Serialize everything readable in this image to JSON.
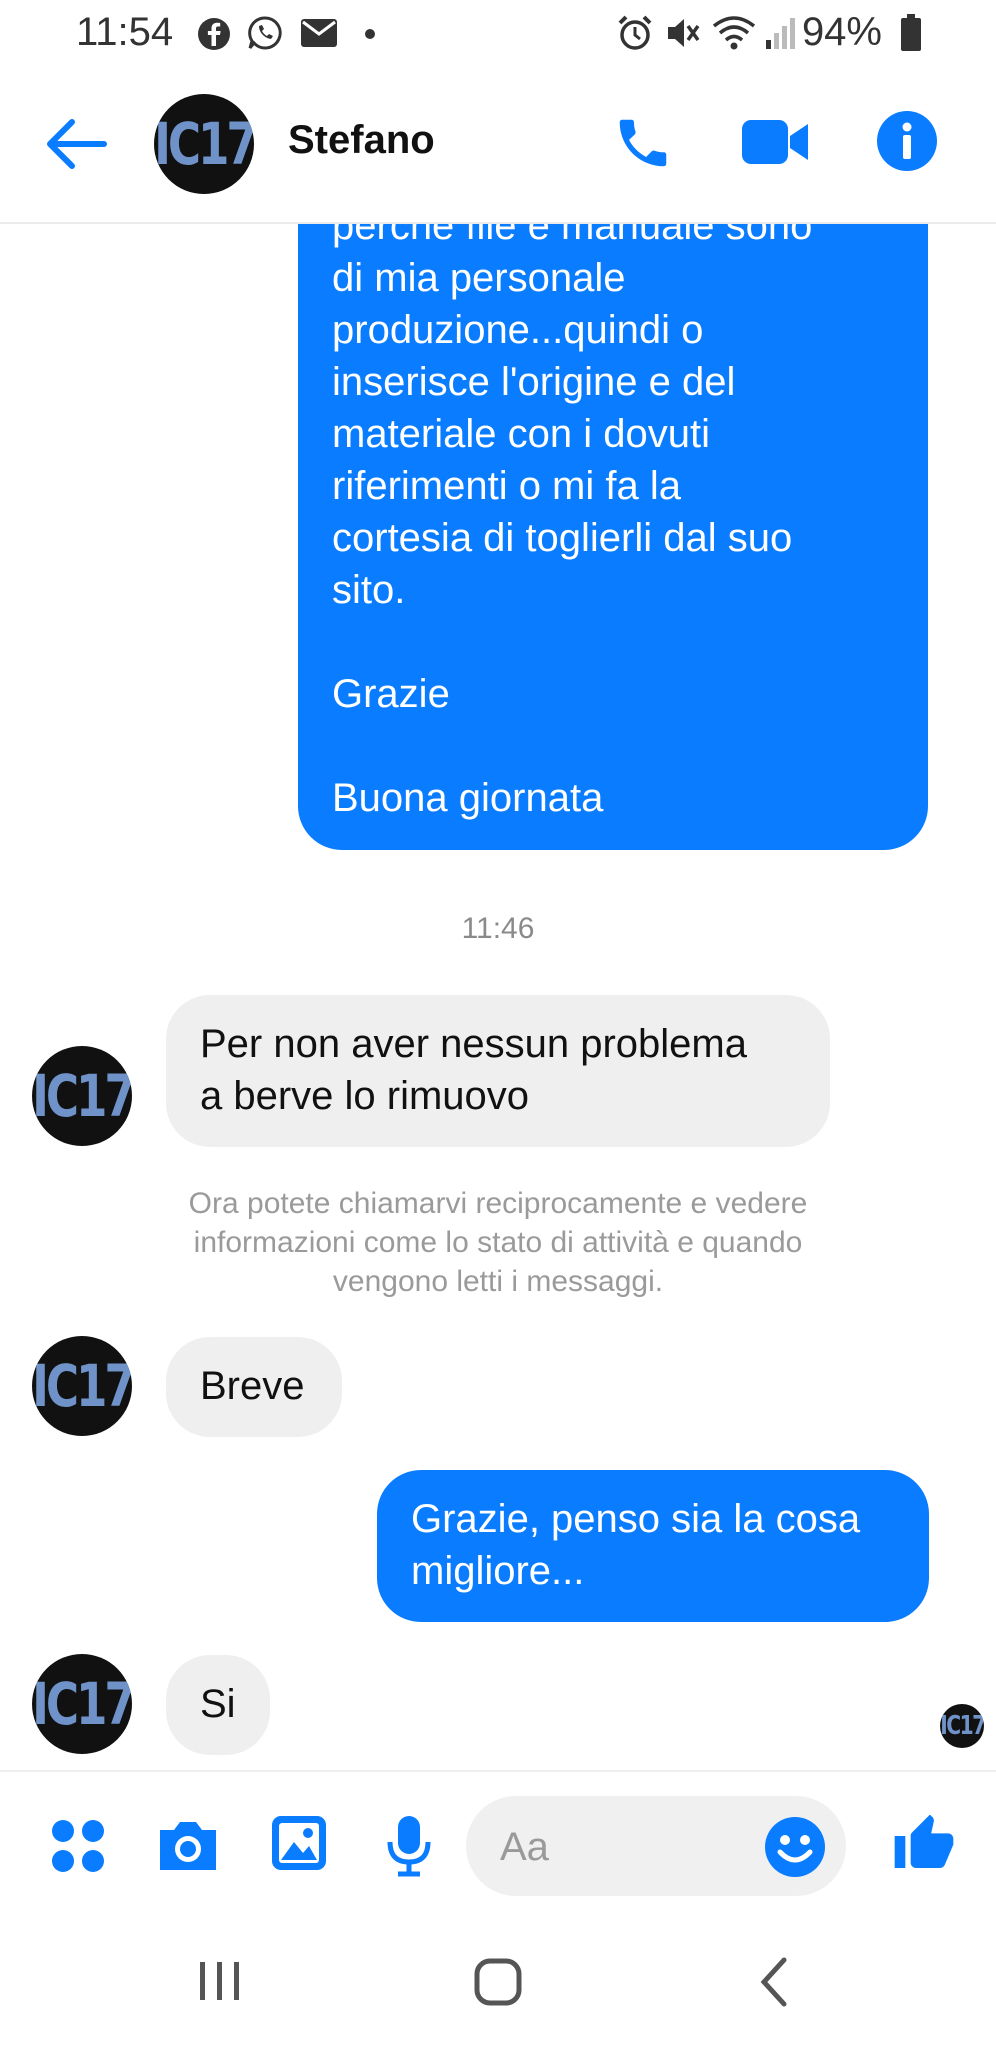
{
  "status_bar": {
    "time": "11:54",
    "battery": "94%",
    "left_icons": [
      "facebook-icon",
      "whatsapp-icon",
      "mail-icon",
      "dot-icon"
    ],
    "right_icons": [
      "alarm-icon",
      "mute-icon",
      "wifi-icon",
      "signal-icon",
      "battery-icon"
    ]
  },
  "header": {
    "back_icon": "arrow-left-icon",
    "avatar_text": "IC17",
    "contact_name": "Stefano",
    "actions": [
      "phone-icon",
      "video-icon",
      "info-icon"
    ],
    "accent_color": "#0a7cff"
  },
  "messages": {
    "first_outgoing": {
      "partial_line": "perchè file e manuale sono",
      "lines": [
        "di mia personale",
        "produzione...quindi o",
        "inserisce l'origine e del",
        "materiale con i dovuti",
        "riferimenti o mi fa la",
        "cortesia di toglierli dal suo",
        "sito."
      ],
      "thanks": "Grazie",
      "closing": "Buona giornata"
    },
    "timestamp": "11:46",
    "incoming_1": [
      "Per non aver nessun problema",
      "a berve lo rimuovo"
    ],
    "system_note": "Ora potete chiamarvi reciprocamente e vedere informazioni come lo stato di attività e quando vengono letti i messaggi.",
    "incoming_2": "Breve",
    "outgoing_2": [
      "Grazie, penso sia la cosa",
      "migliore..."
    ],
    "incoming_3": "Si"
  },
  "composer": {
    "icons": [
      "apps-icon",
      "camera-icon",
      "gallery-icon",
      "microphone-icon",
      "emoji-icon",
      "like-icon"
    ],
    "placeholder": "Aa"
  },
  "navigation": [
    "recent-apps-icon",
    "home-icon",
    "back-icon"
  ]
}
